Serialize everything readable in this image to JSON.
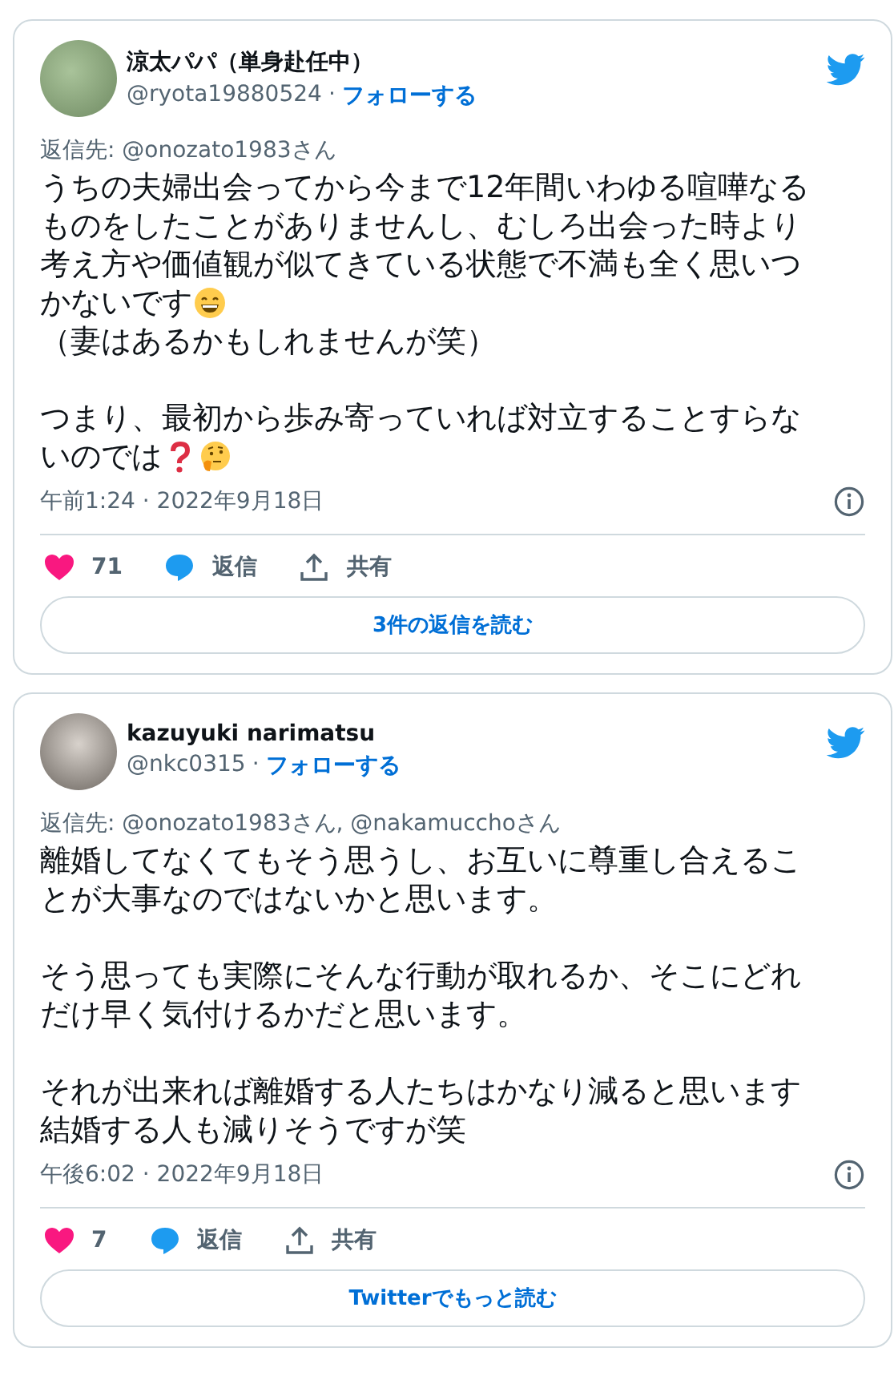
{
  "tweets": [
    {
      "name": "涼太パパ（単身赴任中）",
      "handle": "@ryota19880524",
      "separator": "·",
      "follow": "フォローする",
      "reply_to": "返信先: @onozato1983さん",
      "body": [
        [
          {
            "text": "うちの夫婦出会ってから今まで12年間いわゆる喧嘩なる"
          },
          {
            "text": "ものをしたことがありませんし、むしろ出会った時より"
          },
          {
            "text": "考え方や価値観が似てきている状態で不満も全く思いつ"
          },
          {
            "text": "かないです",
            "emoji": [
              {
                "kind": "grin"
              }
            ]
          },
          {
            "text": "（妻はあるかもしれませんが笑）"
          }
        ],
        [
          {
            "text": "つまり、最初から歩み寄っていれば対立することすらな"
          },
          {
            "text": "いのでは",
            "emoji": [
              {
                "kind": "question"
              },
              {
                "kind": "thinking"
              }
            ]
          }
        ]
      ],
      "time": "午前1:24 · 2022年9月18日",
      "likes": "71",
      "reply": "返信",
      "share": "共有",
      "more_button": "3件の返信を読む"
    },
    {
      "name": "kazuyuki narimatsu",
      "handle": "@nkc0315",
      "separator": "·",
      "follow": "フォローする",
      "reply_to": "返信先: @onozato1983さん, @nakamucchoさん",
      "body": [
        [
          {
            "text": "離婚してなくてもそう思うし、お互いに尊重し合えるこ"
          },
          {
            "text": "とが大事なのではないかと思います。"
          }
        ],
        [
          {
            "text": "そう思っても実際にそんな行動が取れるか、そこにどれ"
          },
          {
            "text": "だけ早く気付けるかだと思います。"
          }
        ],
        [
          {
            "text": "それが出来れば離婚する人たちはかなり減ると思います"
          },
          {
            "text": "結婚する人も減りそうですが笑"
          }
        ]
      ],
      "time": "午後6:02 · 2022年9月18日",
      "likes": "7",
      "reply": "返信",
      "share": "共有",
      "more_button": "Twitterでもっと読む"
    }
  ]
}
